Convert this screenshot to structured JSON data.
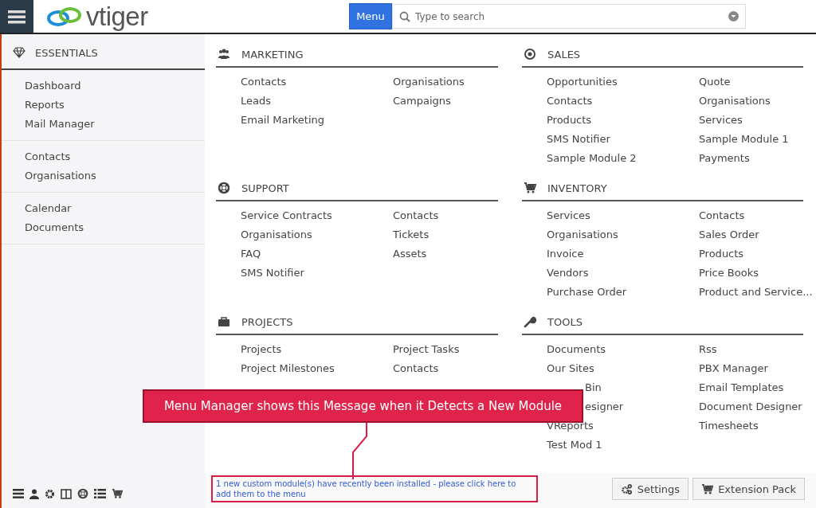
{
  "topbar": {
    "logo": "vtiger",
    "menu_button": "Menu",
    "search": {
      "placeholder": "Type to search"
    }
  },
  "sidebar": {
    "title": "ESSENTIALS",
    "groups": [
      [
        "Dashboard",
        "Reports",
        "Mail Manager"
      ],
      [
        "Contacts",
        "Organisations"
      ],
      [
        "Calendar",
        "Documents"
      ]
    ]
  },
  "sections": [
    {
      "kind": "marketing",
      "title": "MARKETING",
      "columns": [
        [
          {
            "text": "Contacts"
          },
          {
            "text": "Leads"
          },
          {
            "text": "Email Marketing"
          }
        ],
        [
          {
            "text": "Organisations"
          },
          {
            "text": "Campaigns"
          }
        ]
      ]
    },
    {
      "kind": "sales",
      "title": "SALES",
      "columns": [
        [
          {
            "text": "Opportunities"
          },
          {
            "text": "Contacts"
          },
          {
            "text": "Products"
          },
          {
            "text": "SMS Notifier"
          },
          {
            "text": "Sample Module 2"
          }
        ],
        [
          {
            "text": "Quote"
          },
          {
            "text": "Organisations"
          },
          {
            "text": "Services"
          },
          {
            "text": "Sample Module 1"
          },
          {
            "text": "Payments"
          }
        ]
      ]
    },
    {
      "kind": "support",
      "title": "SUPPORT",
      "columns": [
        [
          {
            "text": "Service Contracts"
          },
          {
            "text": "Organisations"
          },
          {
            "text": "FAQ"
          },
          {
            "text": "SMS Notifier"
          }
        ],
        [
          {
            "text": "Contacts"
          },
          {
            "text": "Tickets"
          },
          {
            "text": "Assets"
          }
        ]
      ]
    },
    {
      "kind": "inventory",
      "title": "INVENTORY",
      "columns": [
        [
          {
            "text": "Services"
          },
          {
            "text": "Organisations"
          },
          {
            "text": "Invoice"
          },
          {
            "text": "Vendors"
          },
          {
            "text": "Purchase Order"
          }
        ],
        [
          {
            "text": "Contacts"
          },
          {
            "text": "Sales Order"
          },
          {
            "text": "Products"
          },
          {
            "text": "Price Books"
          },
          {
            "text": "Product and Service..."
          }
        ]
      ]
    },
    {
      "kind": "projects",
      "title": "PROJECTS",
      "columns": [
        [
          {
            "text": "Projects"
          },
          {
            "text": "Project Milestones"
          }
        ],
        [
          {
            "text": "Project Tasks"
          },
          {
            "text": "Contacts"
          }
        ]
      ]
    },
    {
      "kind": "tools",
      "title": "TOOLS",
      "columns": [
        [
          {
            "text": "Documents"
          },
          {
            "text": "Our Sites"
          },
          {
            "text": "Bin",
            "kind": "clipped"
          },
          {
            "text": "esigner",
            "kind": "clipped"
          },
          {
            "text": "VReports"
          },
          {
            "text": "Test Mod 1"
          }
        ],
        [
          {
            "text": "Rss"
          },
          {
            "text": "PBX Manager"
          },
          {
            "text": "Email Templates"
          },
          {
            "text": "Document Designer"
          },
          {
            "text": "Timesheets"
          }
        ]
      ]
    }
  ],
  "message": "1 new custom module(s) have recently been installed - please click here to add them to the menu",
  "buttons": [
    {
      "kind": "settings",
      "label": "Settings"
    },
    {
      "kind": "extensions",
      "label": "Extension Pack"
    }
  ],
  "callout": "Menu Manager shows this Message when it Detects a New Module"
}
